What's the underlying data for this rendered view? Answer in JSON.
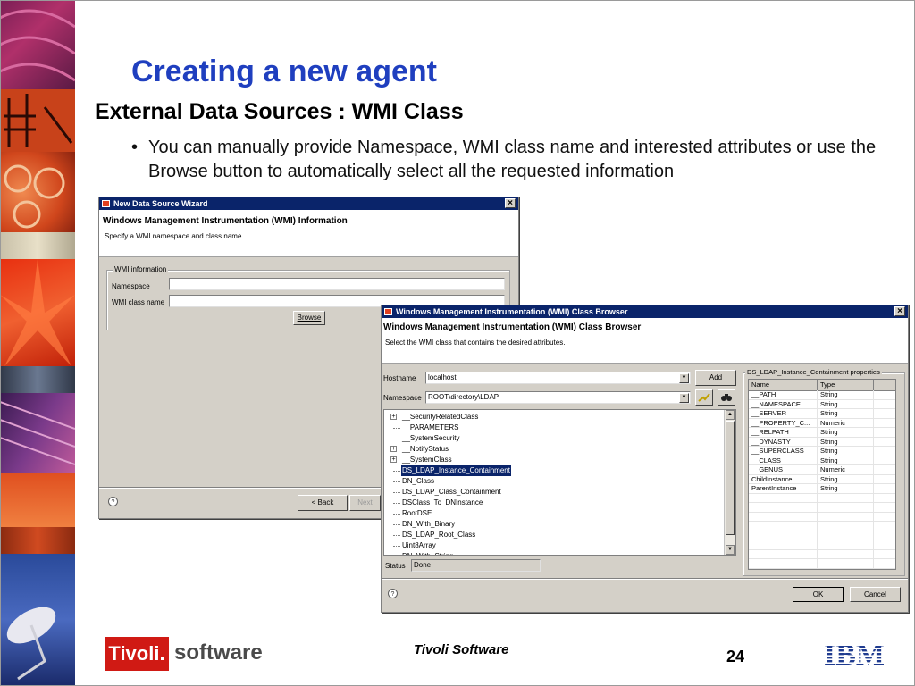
{
  "slide": {
    "title": "Creating a new agent",
    "subtitle": "External Data Sources : WMI Class",
    "bullet_marker": "•",
    "bullet": "You can manually provide Namespace, WMI class name and interested attributes or use the Browse button to automatically select all the requested information"
  },
  "wizard": {
    "window_title": "New Data Source Wizard",
    "header_title": "Windows Management Instrumentation (WMI) Information",
    "header_desc": "Specify a WMI namespace and class name.",
    "group_title": "WMI information",
    "namespace_label": "Namespace",
    "namespace_value": "",
    "class_label": "WMI class name",
    "class_value": "",
    "browse_label": "Browse",
    "back_label": "< Back",
    "next_label": "Next"
  },
  "browser": {
    "window_title": "Windows Management Instrumentation (WMI) Class Browser",
    "header_title": "Windows Management Instrumentation (WMI) Class Browser",
    "header_desc": "Select the WMI class that contains the desired attributes.",
    "hostname_label": "Hostname",
    "hostname_value": "localhost",
    "add_label": "Add",
    "namespace_label": "Namespace",
    "namespace_value": "ROOT\\directory\\LDAP",
    "tree": [
      {
        "label": "__SecurityRelatedClass",
        "expandable": true,
        "selected": false
      },
      {
        "label": "__PARAMETERS",
        "expandable": false,
        "selected": false
      },
      {
        "label": "__SystemSecurity",
        "expandable": false,
        "selected": false
      },
      {
        "label": "__NotifyStatus",
        "expandable": true,
        "selected": false
      },
      {
        "label": "__SystemClass",
        "expandable": true,
        "selected": false
      },
      {
        "label": "DS_LDAP_Instance_Containment",
        "expandable": false,
        "selected": true
      },
      {
        "label": "DN_Class",
        "expandable": false,
        "selected": false
      },
      {
        "label": "DS_LDAP_Class_Containment",
        "expandable": false,
        "selected": false
      },
      {
        "label": "DSClass_To_DNInstance",
        "expandable": false,
        "selected": false
      },
      {
        "label": "RootDSE",
        "expandable": false,
        "selected": false
      },
      {
        "label": "DN_With_Binary",
        "expandable": false,
        "selected": false
      },
      {
        "label": "DS_LDAP_Root_Class",
        "expandable": false,
        "selected": false
      },
      {
        "label": "Uint8Array",
        "expandable": false,
        "selected": false
      },
      {
        "label": "DN_With_String",
        "expandable": false,
        "selected": false
      }
    ],
    "props_title": "DS_LDAP_Instance_Containment properties",
    "props_headers": [
      "Name",
      "Type"
    ],
    "props": [
      [
        "__PATH",
        "String"
      ],
      [
        "__NAMESPACE",
        "String"
      ],
      [
        "__SERVER",
        "String"
      ],
      [
        "__PROPERTY_C...",
        "Numeric"
      ],
      [
        "__RELPATH",
        "String"
      ],
      [
        "__DYNASTY",
        "String"
      ],
      [
        "__SUPERCLASS",
        "String"
      ],
      [
        "__CLASS",
        "String"
      ],
      [
        "__GENUS",
        "Numeric"
      ],
      [
        "ChildInstance",
        "String"
      ],
      [
        "ParentInstance",
        "String"
      ]
    ],
    "status_label": "Status",
    "status_value": "Done",
    "ok_label": "OK",
    "cancel_label": "Cancel"
  },
  "footer": {
    "logo_text": "Tivoli.",
    "logo_suffix": "software",
    "center_text": "Tivoli Software",
    "page_number": "24",
    "ibm_logo": "IBM"
  },
  "colors": {
    "title": "#1f3fbf",
    "titlebar": "#0a246a",
    "tivoli_red": "#d01a14",
    "ibm_blue": "#1f3b8f",
    "dialog_face": "#d4d0c8"
  }
}
